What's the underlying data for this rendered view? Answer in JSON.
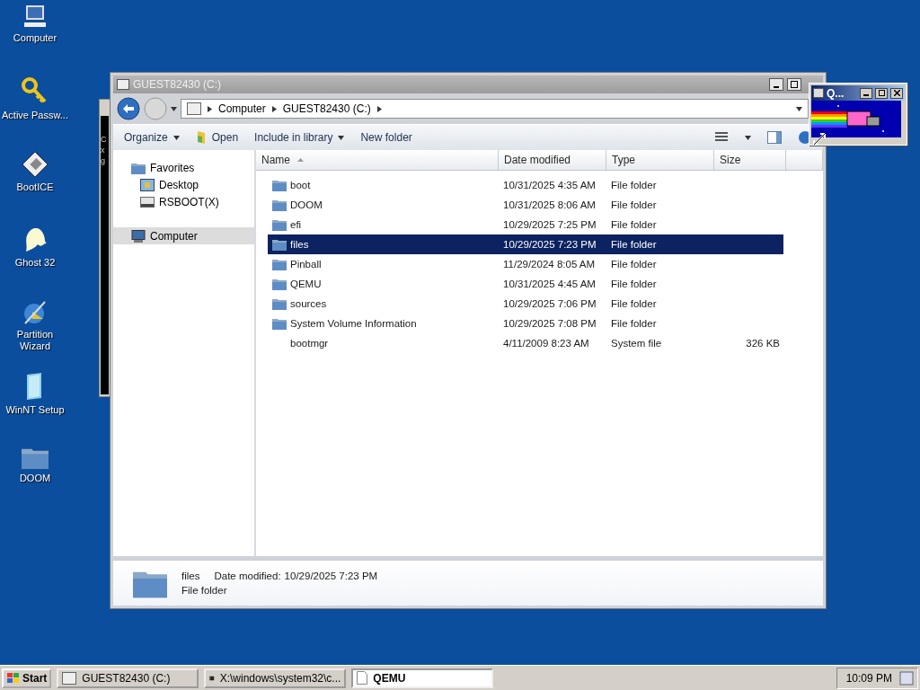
{
  "desktop_icons": [
    {
      "label": "Computer",
      "kind": "computer"
    },
    {
      "label": "Active Passw...",
      "kind": "key"
    },
    {
      "label": "BootICE",
      "kind": "disk"
    },
    {
      "label": "Ghost 32",
      "kind": "ghost"
    },
    {
      "label": "Partition Wizard",
      "kind": "wizard"
    },
    {
      "label": "WinNT Setup",
      "kind": "setup"
    },
    {
      "label": "DOOM",
      "kind": "folder"
    }
  ],
  "console_window": {
    "lines": [
      "C",
      "x",
      "g"
    ]
  },
  "explorer": {
    "title": "GUEST82430 (C:)",
    "breadcrumbs": [
      "Computer",
      "GUEST82430 (C:)"
    ],
    "toolbar": [
      {
        "label": "Organize",
        "kind": "menu"
      },
      {
        "label": "Open",
        "kind": "open"
      },
      {
        "label": "Include in library",
        "kind": "menu"
      },
      {
        "label": "New folder",
        "kind": "plain"
      }
    ],
    "nav": [
      {
        "label": "Favorites",
        "kind": "favorites",
        "selected": false,
        "children": [
          {
            "label": "Desktop",
            "kind": "desktop",
            "selected": false
          },
          {
            "label": "RSBOOT(X)",
            "kind": "drive",
            "selected": false
          }
        ]
      },
      {
        "label": "Computer",
        "kind": "computer",
        "selected": true
      }
    ],
    "columns": [
      "Name",
      "Date modified",
      "Type",
      "Size"
    ],
    "rows": [
      {
        "name": "boot",
        "date": "10/31/2025 4:35 AM",
        "type": "File folder",
        "kind": "folder",
        "selected": false
      },
      {
        "name": "DOOM",
        "date": "10/31/2025 8:06 AM",
        "type": "File folder",
        "kind": "folder",
        "selected": false
      },
      {
        "name": "efi",
        "date": "10/29/2025 7:25 PM",
        "type": "File folder",
        "kind": "folder",
        "selected": false
      },
      {
        "name": "files",
        "date": "10/29/2025 7:23 PM",
        "type": "File folder",
        "kind": "folder",
        "selected": true
      },
      {
        "name": "Pinball",
        "date": "11/29/2024 8:05 AM",
        "type": "File folder",
        "kind": "folder",
        "selected": false
      },
      {
        "name": "QEMU",
        "date": "10/31/2025 4:45 AM",
        "type": "File folder",
        "kind": "folder",
        "selected": false
      },
      {
        "name": "sources",
        "date": "10/29/2025 7:06 PM",
        "type": "File folder",
        "kind": "folder",
        "selected": false
      },
      {
        "name": "System Volume Information",
        "date": "10/29/2025 7:08 PM",
        "type": "File folder",
        "kind": "folder",
        "selected": false
      },
      {
        "name": "bootmgr",
        "date": "4/11/2009 8:23 AM",
        "type": "System file",
        "size": "326 KB",
        "kind": "file",
        "selected": false
      }
    ],
    "details": {
      "name": "files",
      "type": "File folder",
      "date_label": "Date modified:",
      "date": "10/29/2025 7:23 PM"
    }
  },
  "qemu_window": {
    "title": "Q..."
  },
  "taskbar": {
    "start": "Start",
    "tasks": [
      {
        "label": "GUEST82430 (C:)",
        "kind": "folder",
        "selected": false
      },
      {
        "label": "X:\\windows\\system32\\c...",
        "kind": "console",
        "selected": false
      },
      {
        "label": "QEMU",
        "kind": "document",
        "selected": true
      }
    ],
    "clock": "10:09 PM"
  }
}
